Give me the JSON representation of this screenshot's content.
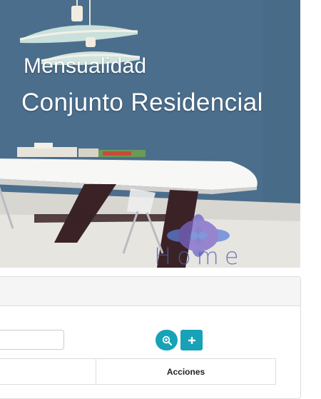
{
  "hero": {
    "subtitle": "Mensualidad",
    "title": "Conjunto Residencial",
    "logo_text": "Home"
  },
  "search": {
    "value": "",
    "placeholder": ""
  },
  "toolbar": {
    "search_icon": "zoom-in-icon",
    "add_icon": "plus-icon",
    "accent_color": "#17a2b8"
  },
  "table": {
    "columns": [
      "",
      "Acciones"
    ]
  }
}
